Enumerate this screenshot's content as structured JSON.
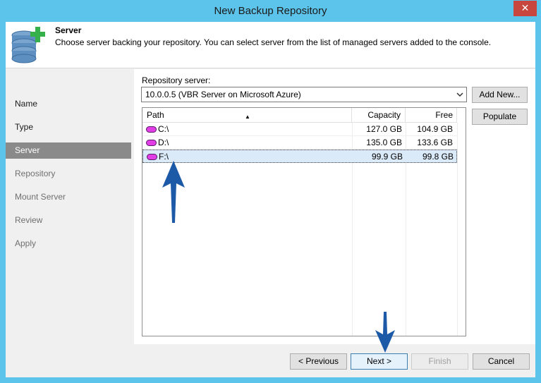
{
  "window": {
    "title": "New Backup Repository",
    "close_glyph": "✕"
  },
  "header": {
    "icon": "database-add-icon",
    "title": "Server",
    "description": "Choose server backing your repository. You can select server from the list of managed servers added to the console."
  },
  "nav": {
    "items": [
      {
        "label": "Name",
        "state": "done"
      },
      {
        "label": "Type",
        "state": "done"
      },
      {
        "label": "Server",
        "state": "active"
      },
      {
        "label": "Repository",
        "state": "future"
      },
      {
        "label": "Mount Server",
        "state": "future"
      },
      {
        "label": "Review",
        "state": "future"
      },
      {
        "label": "Apply",
        "state": "future"
      }
    ]
  },
  "server": {
    "label": "Repository server:",
    "selected": "10.0.0.5 (VBR Server on Microsoft Azure)",
    "add_new": "Add New...",
    "populate": "Populate"
  },
  "grid": {
    "columns": [
      "Path",
      "Capacity",
      "Free"
    ],
    "rows": [
      {
        "path": "C:\\",
        "capacity": "127.0 GB",
        "free": "104.9 GB",
        "selected": false
      },
      {
        "path": "D:\\",
        "capacity": "135.0 GB",
        "free": "133.6 GB",
        "selected": false
      },
      {
        "path": "F:\\",
        "capacity": "99.9 GB",
        "free": "99.8 GB",
        "selected": true
      }
    ]
  },
  "footer": {
    "previous": "< Previous",
    "next": "Next >",
    "finish": "Finish",
    "cancel": "Cancel"
  },
  "colors": {
    "titlebar": "#5cc3ea",
    "accent_arrow": "#1c5aa8",
    "drive": "#e13ee6",
    "close": "#c7463d"
  }
}
